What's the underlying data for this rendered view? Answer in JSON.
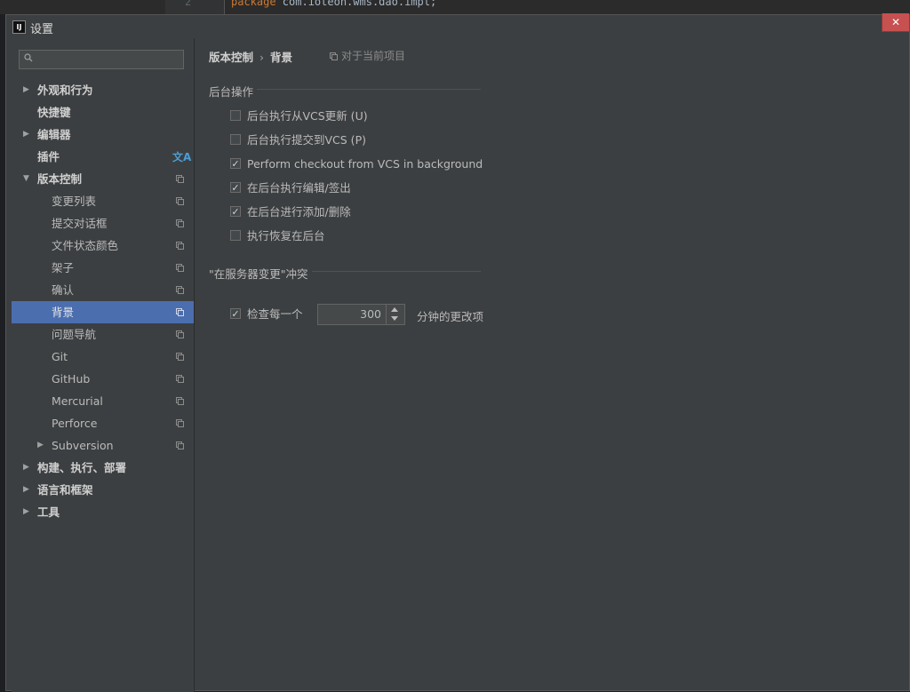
{
  "background": {
    "line_number": "2",
    "code_keyword": "package",
    "code_rest": " com.ioteon.wms.dao.impl;"
  },
  "window": {
    "title": "设置",
    "app_icon_text": "IJ",
    "close_symbol": "✕"
  },
  "sidebar": {
    "search_placeholder": "",
    "items": [
      {
        "label": "外观和行为",
        "arrow": "▶"
      },
      {
        "label": "快捷键"
      },
      {
        "label": "编辑器",
        "arrow": "▶"
      },
      {
        "label": "插件",
        "icon": "translate-icon",
        "icon_glyph": "文A"
      },
      {
        "label": "版本控制",
        "arrow": "▼"
      },
      {
        "label": "变更列表"
      },
      {
        "label": "提交对话框"
      },
      {
        "label": "文件状态颜色"
      },
      {
        "label": "架子"
      },
      {
        "label": "确认"
      },
      {
        "label": "背景"
      },
      {
        "label": "问题导航"
      },
      {
        "label": "Git"
      },
      {
        "label": "GitHub"
      },
      {
        "label": "Mercurial"
      },
      {
        "label": "Perforce"
      },
      {
        "label": "Subversion",
        "arrow": "▶"
      },
      {
        "label": "构建、执行、部署",
        "arrow": "▶"
      },
      {
        "label": "语言和框架",
        "arrow": "▶"
      },
      {
        "label": "工具",
        "arrow": "▶"
      }
    ]
  },
  "main": {
    "breadcrumb_parent": "版本控制",
    "breadcrumb_sep": "›",
    "breadcrumb_current": "背景",
    "scope_label": "对于当前项目",
    "section_background": "后台操作",
    "checkboxes": [
      {
        "label": "后台执行从VCS更新 (U)",
        "checked": false
      },
      {
        "label": "后台执行提交到VCS (P)",
        "checked": false
      },
      {
        "label": "Perform checkout from VCS in background",
        "checked": true
      },
      {
        "label": "在后台执行编辑/签出",
        "checked": true
      },
      {
        "label": "在后台进行添加/删除",
        "checked": true
      },
      {
        "label": "执行恢复在后台",
        "checked": false
      }
    ],
    "section_conflict": "\"在服务器变更\"冲突",
    "check_every": {
      "label": "检查每一个",
      "checked": true,
      "value": "300",
      "suffix": "分钟的更改项"
    },
    "check_mark": "✓"
  },
  "colors": {
    "selection": "#4b6eaf",
    "panel": "#3c3f41",
    "close": "#c75050"
  }
}
